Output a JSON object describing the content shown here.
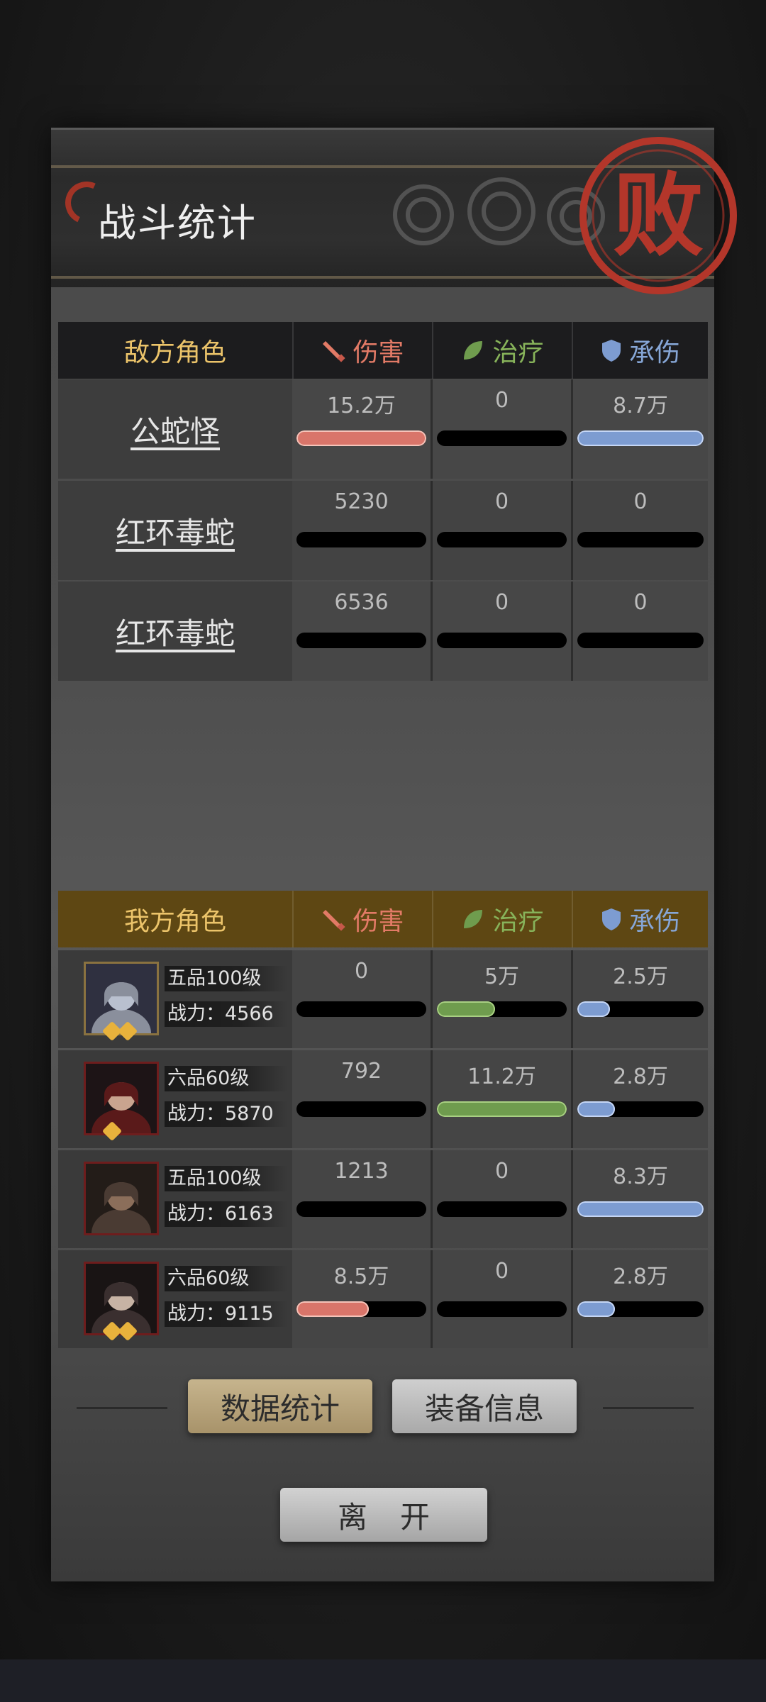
{
  "title": "战斗统计",
  "result_seal": "败",
  "columns": {
    "damage": "伤害",
    "heal": "治疗",
    "tank": "承伤"
  },
  "icons": {
    "damage": "sword-icon",
    "heal": "leaf-icon",
    "tank": "shield-icon"
  },
  "colors": {
    "damage": "#d9756a",
    "heal": "#6f9c4e",
    "tank": "#7d9cd1",
    "enemy_header_label": "#ecc46a",
    "seal": "#b3362a"
  },
  "enemy": {
    "label": "敌方角色",
    "rows": [
      {
        "name": "公蛇怪",
        "damage": "15.2万",
        "heal": "0",
        "tank": "8.7万",
        "damage_frac": 1.0,
        "heal_frac": 0,
        "tank_frac": 1.0
      },
      {
        "name": "红环毒蛇",
        "damage": "5230",
        "heal": "0",
        "tank": "0",
        "damage_frac": 0,
        "heal_frac": 0,
        "tank_frac": 0
      },
      {
        "name": "红环毒蛇",
        "damage": "6536",
        "heal": "0",
        "tank": "0",
        "damage_frac": 0,
        "heal_frac": 0,
        "tank_frac": 0
      }
    ]
  },
  "ally": {
    "label": "我方角色",
    "rows": [
      {
        "rank": "五品100级",
        "power": "战力：4566",
        "stars": 2,
        "damage": "0",
        "heal": "5万",
        "tank": "2.5万",
        "damage_frac": 0,
        "heal_frac": 0.45,
        "tank_frac": 0.26
      },
      {
        "rank": "六品60级",
        "power": "战力：5870",
        "stars": 1,
        "damage": "792",
        "heal": "11.2万",
        "tank": "2.8万",
        "damage_frac": 0,
        "heal_frac": 1.0,
        "tank_frac": 0.3
      },
      {
        "rank": "五品100级",
        "power": "战力：6163",
        "stars": 0,
        "damage": "1213",
        "heal": "0",
        "tank": "8.3万",
        "damage_frac": 0,
        "heal_frac": 0,
        "tank_frac": 1.0
      },
      {
        "rank": "六品60级",
        "power": "战力：9115",
        "stars": 2,
        "damage": "8.5万",
        "heal": "0",
        "tank": "2.8万",
        "damage_frac": 0.56,
        "heal_frac": 0,
        "tank_frac": 0.3
      }
    ]
  },
  "buttons": {
    "stats": "数据统计",
    "equipment": "装备信息",
    "leave": "离开"
  }
}
